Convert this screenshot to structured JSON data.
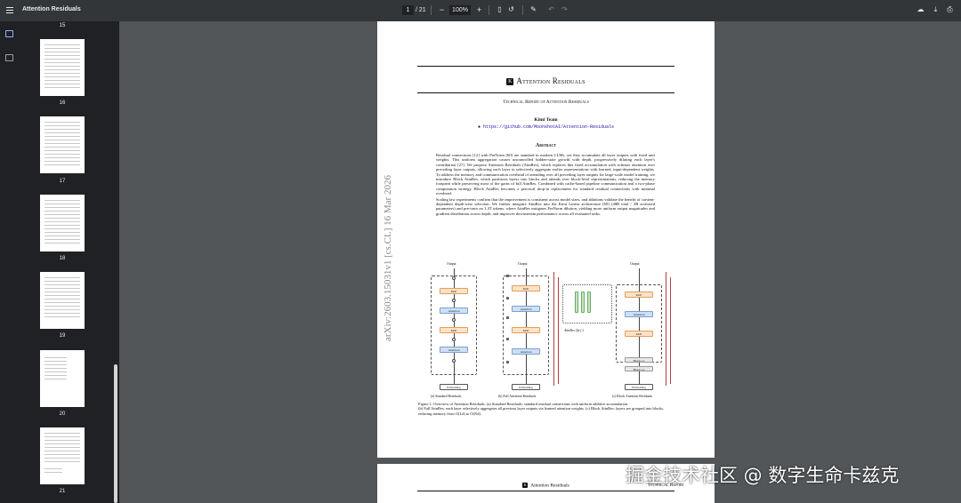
{
  "toolbar": {
    "title": "Attention Residuals",
    "current_page": "1",
    "total_pages": "/ 21",
    "zoom": "100%",
    "zoom_out": "−",
    "zoom_in": "+"
  },
  "thumbnails": [
    {
      "label": "15",
      "active": false
    },
    {
      "label": "16",
      "active": false
    },
    {
      "label": "17",
      "active": false
    },
    {
      "label": "18",
      "active": false
    },
    {
      "label": "19",
      "active": false
    },
    {
      "label": "20",
      "active": false
    },
    {
      "label": "21",
      "active": false
    }
  ],
  "page1": {
    "arxiv_stamp": "arXiv:2603.15031v1  [cs.CL]  16 Mar 2026",
    "title": "Attention Residuals",
    "subtitle": "Technical Report of Attention Residuals",
    "team": "Kimi Team",
    "url": "https://github.com/MoonshotAI/Attention-Residuals",
    "abstract_heading": "Abstract",
    "abstract_p1": "Residual connections [12] with PreNorm [60] are standard in modern LLMs, yet they accumulate all layer outputs with fixed unit weights. This uniform aggregation causes uncontrolled hidden-state growth with depth, progressively diluting each layer's contribution [27]. We propose Attention Residuals (AttnRes), which replaces this fixed accumulation with softmax attention over preceding layer outputs, allowing each layer to selectively aggregate earlier representations with learned, input-dependent weights. To address the memory and communication overhead of attending over all preceding layer outputs for large-scale model training, we introduce Block AttnRes, which partitions layers into blocks and attends over block-level representations, reducing the memory footprint while preserving most of the gains of full AttnRes. Combined with cache-based pipeline communication and a two-phase computation strategy, Block AttnRes becomes a practical drop-in replacement for standard residual connections with minimal overhead.",
    "abstract_p2": "Scaling law experiments confirm that the improvement is consistent across model sizes, and ablations validate the benefit of content-dependent depth-wise selection. We further integrate AttnRes into the Kimi Linear architecture [69] (48B total / 3B activated parameters) and pre-train on 1.4T tokens, where AttnRes mitigates PreNorm dilution, yielding more uniform output magnitudes and gradient distribution across depth, and improves downstream performance across all evaluated tasks.",
    "fig_output": "Output",
    "fig_mlp": "MoE",
    "fig_attention": "Attention",
    "fig_embedding": "Embedding",
    "fig_block1": "Block t-1",
    "fig_block2": "Block t-2",
    "fig_op": "AttnRes Op (·)",
    "cap_a": "(a) Standard Residuals",
    "cap_b": "(b) Full Attention Residuals",
    "cap_c": "(c) Block Attention Residuals",
    "figure_caption_1": "Figure 1: Overview of Attention Residuals. (a) Standard Residuals: standard residual connections with uniform additive accumulation.",
    "figure_caption_2": "(b) Full AttnRes: each layer selectively aggregates all previous layer outputs via learned attention weights. (c) Block AttnRes: layers are grouped into blocks, reducing memory from O(Ld) to O(Nd)."
  },
  "page2": {
    "header": "Attention Residuals",
    "header_right": "Technical Report"
  },
  "watermark": "掘金技术社区 @ 数字生命卡兹克"
}
